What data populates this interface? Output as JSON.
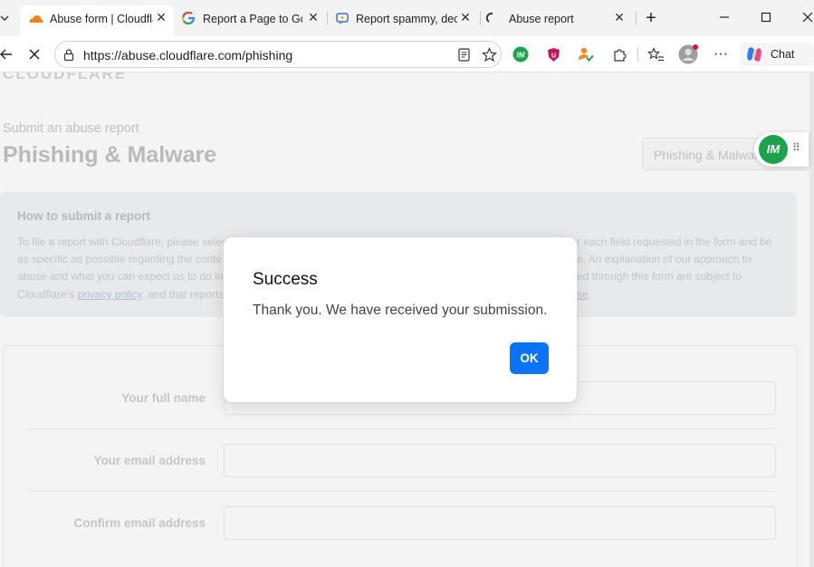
{
  "browser": {
    "tabs": [
      {
        "title": "Abuse form | Cloudfla",
        "favicon": "cloudflare-icon",
        "active": true
      },
      {
        "title": "Report a Page to Goo",
        "favicon": "google-icon",
        "active": false
      },
      {
        "title": "Report spammy, dece",
        "favicon": "report-icon",
        "active": false
      },
      {
        "title": "Abuse report",
        "favicon": "loading-icon",
        "active": false
      }
    ],
    "url": "https://abuse.cloudflare.com/phishing",
    "chat_label": "Chat",
    "colors": {
      "accent": "#0b74f5",
      "brand": "#f38020",
      "extension_green": "#1aa34a"
    }
  },
  "page": {
    "logo": "CLOUDFLARE",
    "breadcrumb": "Submit an abuse report",
    "title": "Phishing & Malware",
    "category_select": "Phishing & Malware",
    "info": {
      "heading": "How to submit a report",
      "line1_left": "To file a report with Cloudflare, please selec",
      "line1_right": "r each field requested in the form and be",
      "line2_left": "as specific as possible regarding the conte",
      "line2_right": "e. An explanation of our approach to",
      "line3_left": "abuse and what you can expect us to do in",
      "line3_right": "ed through this form are subject to",
      "line4_left": "Cloudflare's ",
      "line4_link": "privacy policy",
      "line4_mid": ", and that reports",
      "line4_right_link": "se",
      "line4_end": "."
    },
    "form": {
      "full_name_label": "Your full name",
      "email_label": "Your email address",
      "confirm_email_label": "Confirm email address"
    }
  },
  "widget": {
    "badge": "IM"
  },
  "dialog": {
    "title": "Success",
    "message": "Thank you. We have received your submission.",
    "ok_label": "OK"
  }
}
